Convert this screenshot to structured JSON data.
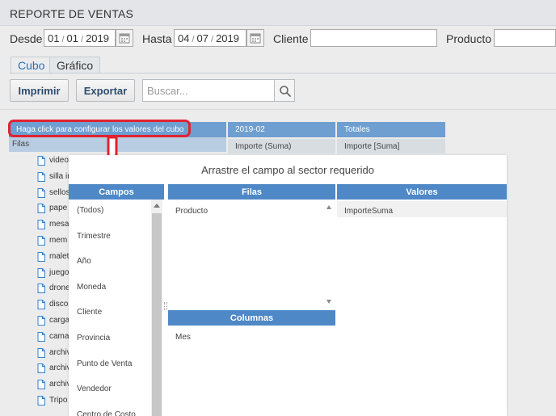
{
  "app": {
    "title": "REPORTE DE VENTAS"
  },
  "filters": {
    "desde_label": "Desde",
    "desde": {
      "day": "01",
      "month": "01",
      "year": "2019"
    },
    "hasta_label": "Hasta",
    "hasta": {
      "day": "04",
      "month": "07",
      "year": "2019"
    },
    "date_separator": "/",
    "cliente_label": "Cliente",
    "producto_label": "Producto"
  },
  "tabs": [
    {
      "label": "Cubo",
      "active": true
    },
    {
      "label": "Gráfico",
      "active": false
    }
  ],
  "toolbar": {
    "print_label": "Imprimir",
    "export_label": "Exportar",
    "search_placeholder": "Buscar..."
  },
  "pivot": {
    "config_label": "Haga click para configurar los valores del cubo",
    "rows_label": "Filas",
    "column_header": "2019-02",
    "totals_header": "Totales",
    "measure_label": "Importe (Suma)",
    "totals_measure_label": "Importe [Suma]",
    "row_items": [
      "video",
      "silla ir",
      "sellos",
      "pape",
      "mesa",
      "mem",
      "malet",
      "juego",
      "drone",
      "disco",
      "carga",
      "cama",
      "archiv",
      "archiv",
      "archiv",
      "Tripo"
    ]
  },
  "dialog": {
    "title": "Arrastre el campo al sector requerido",
    "fields_header": "Campos",
    "rows_header": "Filas",
    "values_header": "Valores",
    "columns_header": "Columnas",
    "fields": [
      "(Todos)",
      "Trimestre",
      "Año",
      "Moneda",
      "Cliente",
      "Provincia",
      "Punto de Venta",
      "Vendedor",
      "Centro de Costo"
    ],
    "rows_items": [
      "Producto"
    ],
    "values_items": [
      "ImporteSuma"
    ],
    "columns_items": [
      "Mes"
    ]
  },
  "colors": {
    "accent_blue": "#4f88c6",
    "header_blue": "#6f9ed0",
    "annotation_red": "#e2222f",
    "tab_active_text": "#2a6fb3"
  }
}
